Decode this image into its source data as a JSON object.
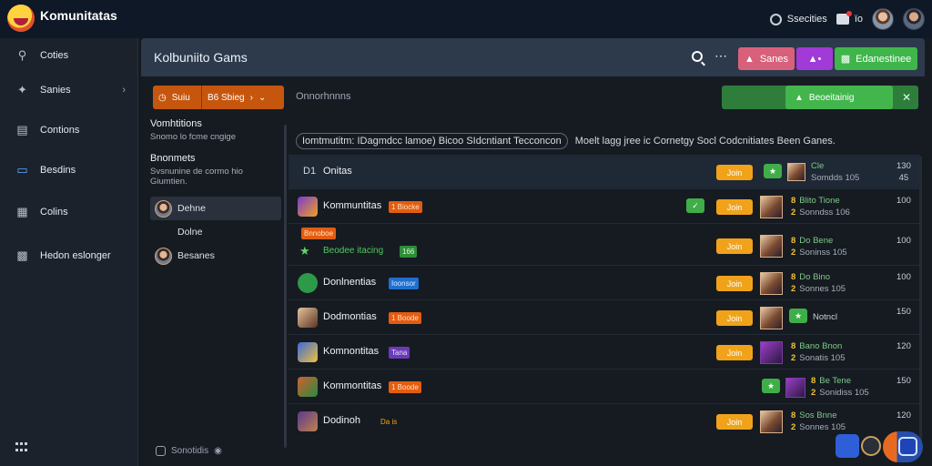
{
  "app": {
    "name": "Komunitatas"
  },
  "topbar": {
    "search_label": "Ssecities",
    "notif_label": "ïo"
  },
  "sidebar": {
    "items": [
      {
        "label": "Coties",
        "icon": "search-icon"
      },
      {
        "label": "Sanies",
        "icon": "tools-icon"
      },
      {
        "label": "Contions",
        "icon": "list-icon"
      },
      {
        "label": "Besdins",
        "icon": "tablet-icon"
      },
      {
        "label": "Colins",
        "icon": "building-icon"
      },
      {
        "label": "Hedon eslonger",
        "icon": "calculator-icon"
      }
    ]
  },
  "header": {
    "title": "Kolbuniito Gams",
    "btn_pink": "Sanes",
    "btn_green": "Edanestinee"
  },
  "filter": {
    "seg1": "Suiu",
    "seg2": "B6 Sbieg",
    "text": "Onnorhnnns"
  },
  "join_bar": {
    "label": "Beoeitainig"
  },
  "panel": {
    "h1": "Vomhtitions",
    "s1": "Snomo lo fcme cngige",
    "h2": "Bnonmets",
    "s2": "Svsnunine de cormo hio Giumtien.",
    "members": [
      "Dehne",
      "Dolne",
      "Besanes"
    ],
    "footer": "Sonotidis"
  },
  "list_head": {
    "chip": "Iomtmutitm: IDagmdcc lamoe) Bicoo SIdcntiant Tecconcon",
    "text": "Moelt lagg jree ic Cornetgy Socl Codcnitiates Been Ganes."
  },
  "list_header_row": {
    "prefix": "D1",
    "name": "Onitas",
    "s1": "Cle",
    "s2": "Somdds 105",
    "count_top": "130",
    "count_bot": "45"
  },
  "rows": [
    {
      "name": "Kommuntitas",
      "badge": "1 Biocke",
      "badge_color": "orange",
      "s1": "Blito Tione",
      "s2": "Sonndss 106",
      "count_top": "100",
      "count_bot": ""
    },
    {
      "name": "",
      "badge": "Bnnoboe",
      "badge_color": "orange",
      "sub": "Beodee itacing",
      "sub_badge": "166",
      "s1": "Do Bene",
      "s2": "Soninss 105",
      "count_top": "100",
      "count_bot": ""
    },
    {
      "name": "Donlnentias",
      "badge": "Ioonsor",
      "badge_color": "blue",
      "s1": "Do Bino",
      "s2": "Sonnes 105",
      "count_top": "100",
      "count_bot": ""
    },
    {
      "name": "Dodmontias",
      "badge": "1 Boode",
      "badge_color": "orange",
      "s1": "Notncl",
      "s2": "",
      "count_top": "150",
      "count_bot": ""
    },
    {
      "name": "Komnontitas",
      "badge": "Tana",
      "badge_color": "violet",
      "s1": "Bano Bnon",
      "s2": "Sonatis 105",
      "count_top": "120",
      "count_bot": ""
    },
    {
      "name": "Kommontitas",
      "badge": "1 Boode",
      "badge_color": "orange",
      "s1": "Be Tene",
      "s2": "Sonidiss 105",
      "count_top": "150",
      "count_bot": ""
    },
    {
      "name": "Dodinoh",
      "badge": "Da is",
      "badge_color": "orange",
      "s1": "Sos Bnne",
      "s2": "Sonnes 105",
      "count_top": "120",
      "count_bot": ""
    }
  ],
  "join_label": "Join",
  "colors": {
    "accent_green": "#43b54d",
    "accent_orange": "#c6560e",
    "accent_yellow": "#f0a31a"
  }
}
